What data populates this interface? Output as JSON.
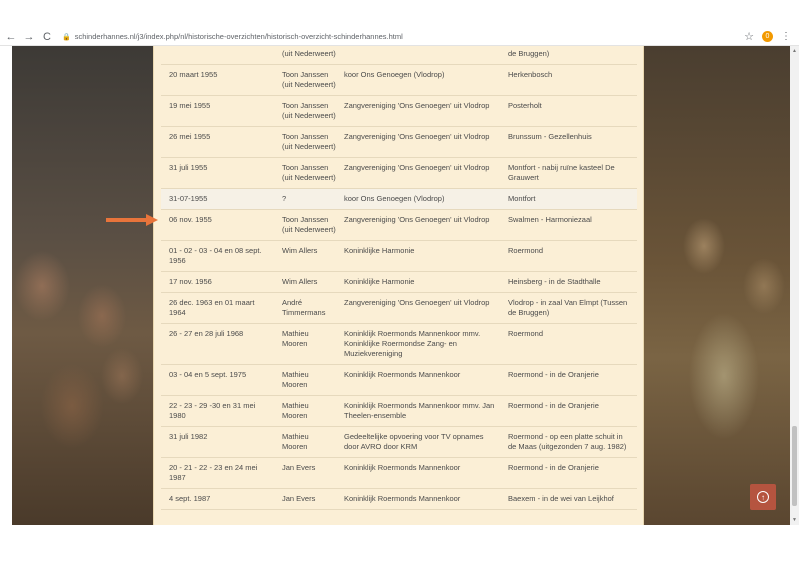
{
  "browser": {
    "url": "schinderhannes.nl/j3/index.php/nl/historische-overzichten/historisch-overzicht-schinderhannes.html",
    "back": "←",
    "forward": "→",
    "reload": "C",
    "lock": "🔒",
    "star": "☆",
    "profile": "0",
    "menu": "⋮"
  },
  "rows": [
    {
      "date": "",
      "who": "(uit Nederweert)",
      "with": "",
      "where": "de Bruggen)"
    },
    {
      "date": "20 maart 1955",
      "who": "Toon Janssen (uit Nederweert)",
      "with": "koor Ons Genoegen (Vlodrop)",
      "where": "Herkenbosch"
    },
    {
      "date": "19 mei 1955",
      "who": "Toon Janssen (uit Nederweert)",
      "with": "Zangvereniging 'Ons Genoegen' uit Vlodrop",
      "where": "Posterholt"
    },
    {
      "date": "26 mei 1955",
      "who": "Toon Janssen (uit Nederweert)",
      "with": "Zangvereniging 'Ons Genoegen' uit Vlodrop",
      "where": "Brunssum - Gezellenhuis"
    },
    {
      "date": "31 juli 1955",
      "who": "Toon Janssen (uit Nederweert)",
      "with": "Zangvereniging 'Ons Genoegen' uit Vlodrop",
      "where": "Montfort - nabij ruïne kasteel De Grauwert"
    },
    {
      "date": "31-07-1955",
      "who": "?",
      "with": "koor Ons Genoegen (Vlodrop)",
      "where": "Montfort"
    },
    {
      "date": "06 nov. 1955",
      "who": "Toon Janssen (uit Nederweert)",
      "with": "Zangvereniging 'Ons Genoegen' uit Vlodrop",
      "where": "Swalmen - Harmoniezaal"
    },
    {
      "date": "01 - 02 - 03 - 04 en 08 sept. 1956",
      "who": "Wim Allers",
      "with": "Koninklijke Harmonie",
      "where": "Roermond"
    },
    {
      "date": "17 nov. 1956",
      "who": "Wim Allers",
      "with": "Koninklijke Harmonie",
      "where": "Heinsberg - in de Stadthalle"
    },
    {
      "date": "26 dec. 1963 en 01 maart 1964",
      "who": "André Timmermans",
      "with": "Zangvereniging 'Ons Genoegen' uit Vlodrop",
      "where": "Vlodrop - in zaal Van Elmpt (Tussen de Bruggen)"
    },
    {
      "date": "26 - 27 en 28 juli 1968",
      "who": "Mathieu Mooren",
      "with": "Koninklijk Roermonds Mannenkoor mmv. Koninklijke Roermondse Zang- en Muziekvereniging",
      "where": "Roermond"
    },
    {
      "date": "03 - 04 en 5 sept. 1975",
      "who": "Mathieu Mooren",
      "with": "Koninklijk Roermonds Mannenkoor",
      "where": "Roermond - in de Oranjerie"
    },
    {
      "date": "22 - 23 - 29 -30 en 31 mei 1980",
      "who": "Mathieu Mooren",
      "with": "Koninklijk Roermonds Mannenkoor mmv. Jan Theelen-ensemble",
      "where": "Roermond - in de Oranjerie"
    },
    {
      "date": "31 juli 1982",
      "who": "Mathieu Mooren",
      "with": "Gedeeltelijke opvoering voor TV opnames door AVRO door KRM",
      "where": "Roermond - op een platte schuit in de Maas (uitgezonden 7 aug. 1982)"
    },
    {
      "date": "20 - 21 - 22 - 23 en 24 mei 1987",
      "who": "Jan Evers",
      "with": "Koninklijk Roermonds Mannenkoor",
      "where": "Roermond - in de Oranjerie"
    },
    {
      "date": "4 sept. 1987",
      "who": "Jan Evers",
      "with": "Koninklijk Roermonds Mannenkoor",
      "where": "Baexem - in de wei van Leijkhof"
    }
  ],
  "highlight_index": 5,
  "colors": {
    "accent": "#e8743b",
    "content_bg": "#fbefd6",
    "up_button": "#b5543f"
  },
  "icons": {
    "arrow": "arrow-right-icon",
    "up": "arrow-up-circle-icon"
  }
}
